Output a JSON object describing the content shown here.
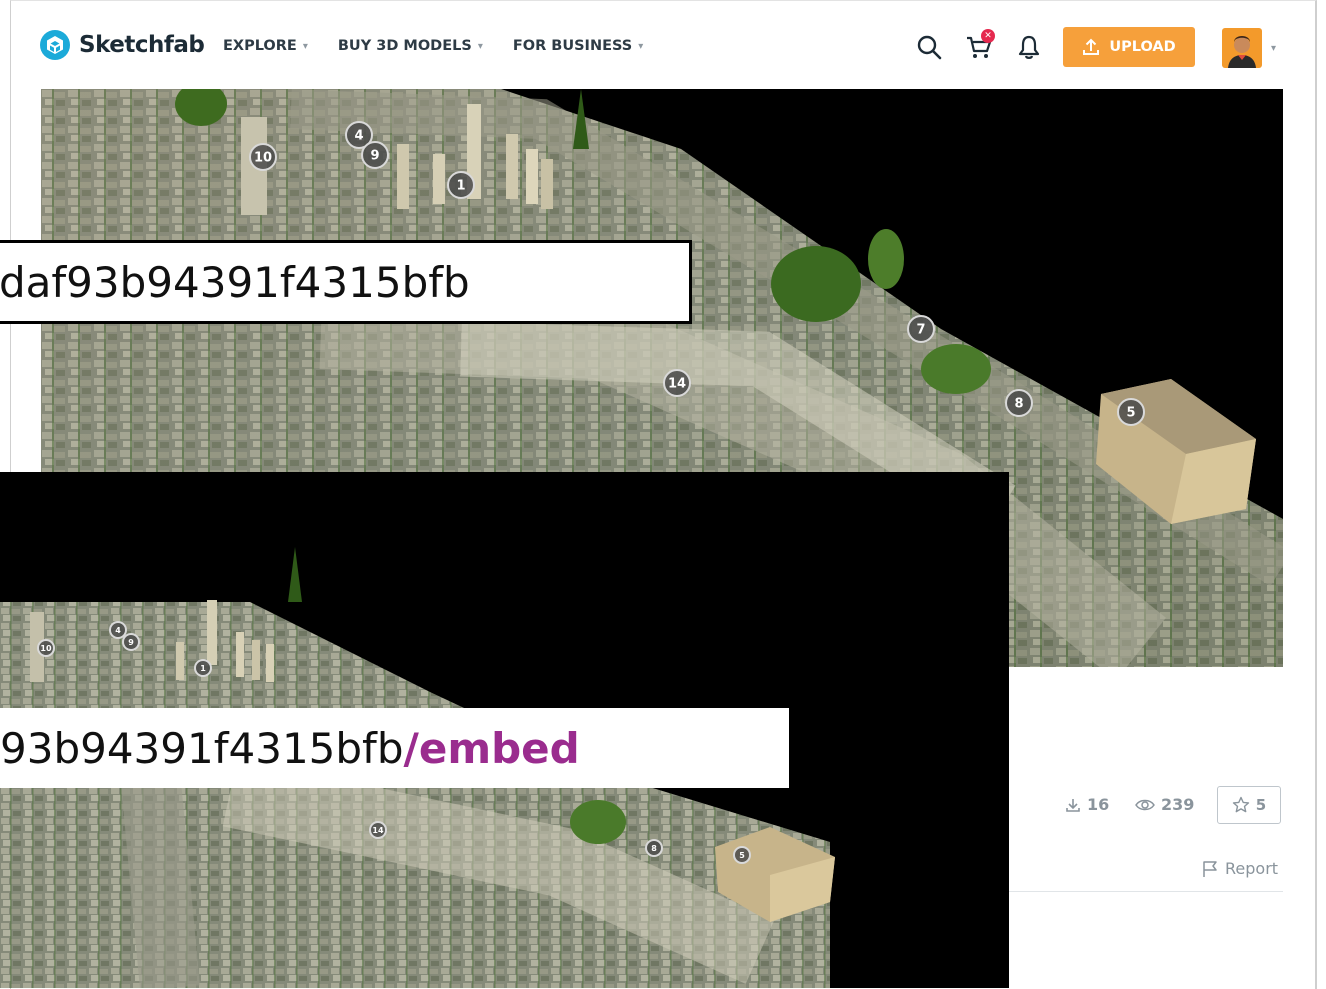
{
  "brand": {
    "name": "Sketchfab"
  },
  "nav": [
    {
      "label": "EXPLORE"
    },
    {
      "label": "BUY 3D MODELS"
    },
    {
      "label": "FOR BUSINESS"
    }
  ],
  "header": {
    "upload_label": "UPLOAD",
    "accent": "#f6a03b"
  },
  "stats": {
    "downloads": "16",
    "views": "239",
    "likes": "5"
  },
  "report_label": "Report",
  "viewer": {
    "annotations_top": [
      "10",
      "4",
      "9",
      "1",
      "7",
      "14",
      "8",
      "5"
    ],
    "annotations_embed": [
      "10",
      "4",
      "9",
      "1",
      "14",
      "8",
      "5"
    ]
  },
  "overlay": {
    "url_fragment": "daf93b94391f4315bfb",
    "embed_url_fragment": "93b94391f4315bfb",
    "embed_suffix": "/embed",
    "embed_color": "#9a2c8e"
  }
}
